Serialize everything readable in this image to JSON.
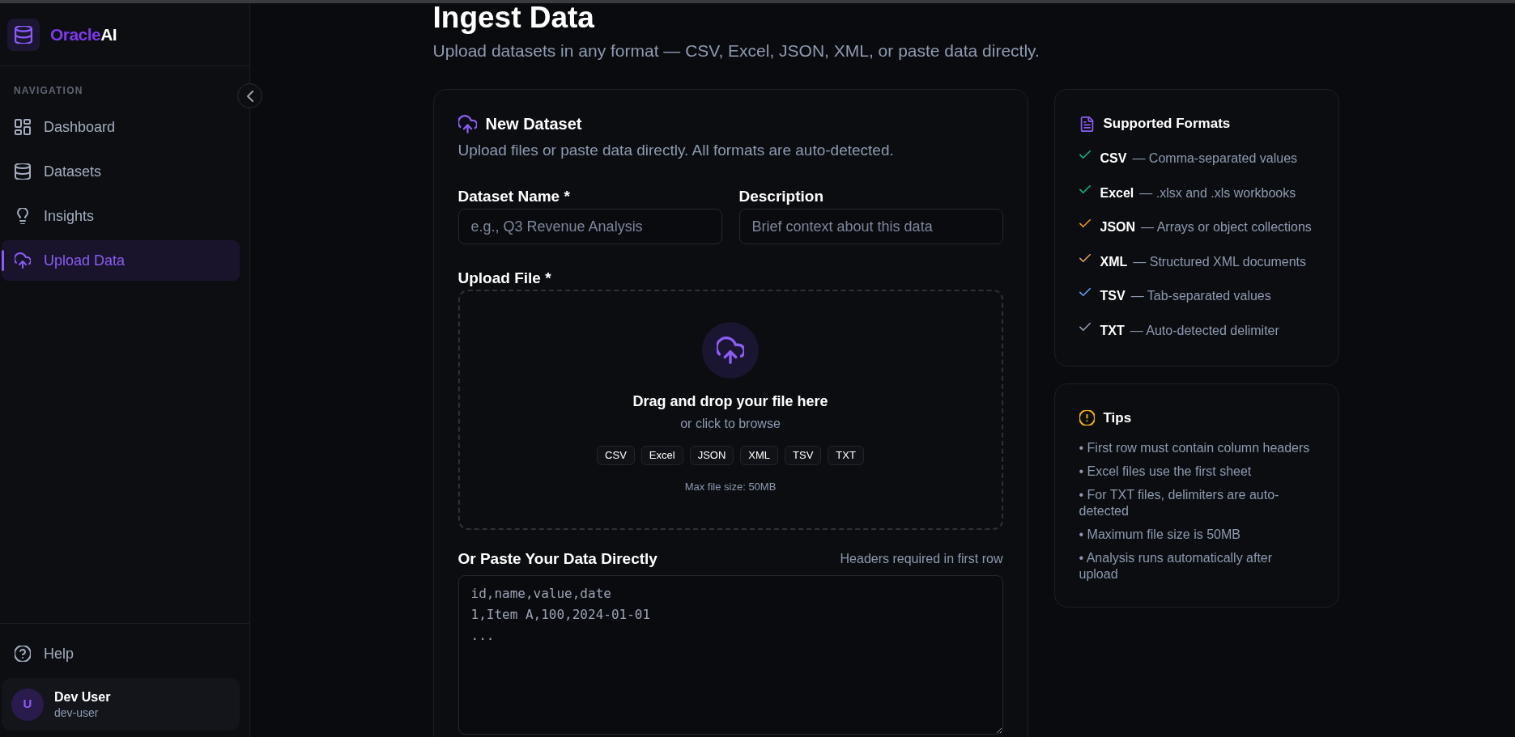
{
  "sidebar": {
    "brand": {
      "name": "Oracle",
      "suffix": "AI"
    },
    "section_label": "NAVIGATION",
    "items": [
      {
        "label": "Dashboard",
        "selected": false
      },
      {
        "label": "Datasets",
        "selected": false
      },
      {
        "label": "Insights",
        "selected": false
      },
      {
        "label": "Upload Data",
        "selected": true
      }
    ],
    "help_link": "Help",
    "user": {
      "initial": "U",
      "name": "Dev User",
      "handle": "dev-user"
    }
  },
  "page": {
    "title": "Ingest Data",
    "subtitle": "Upload datasets in any format — CSV, Excel, JSON, XML, or paste data directly."
  },
  "new_dataset": {
    "title": "New Dataset",
    "subtitle": "Upload files or paste data directly. All formats are auto-detected.",
    "fields": [
      {
        "label": "Dataset Name *",
        "placeholder": "e.g., Q3 Revenue Analysis"
      },
      {
        "label": "Description",
        "placeholder": "Brief context about this data"
      }
    ],
    "upload": {
      "label": "Upload File *",
      "heading": "Drag and drop your file here",
      "hint": "or click to browse",
      "formats": [
        "CSV",
        "Excel",
        "JSON",
        "XML",
        "TSV",
        "TXT"
      ],
      "limit": "Max file size: 50MB"
    },
    "paste": {
      "label": "Or Paste Your Data Directly",
      "note": "Headers required in first row",
      "placeholder": "id,name,value,date\n1,Item A,100,2024-01-01\n..."
    }
  },
  "supported_formats": {
    "title": "Supported Formats",
    "items": [
      {
        "name": "CSV",
        "description": "— Comma-separated values",
        "color": "#10b981"
      },
      {
        "name": "Excel",
        "description": "— .xlsx and .xls workbooks",
        "color": "#10b981"
      },
      {
        "name": "JSON",
        "description": "— Arrays or object collections",
        "color": "#f59e0b"
      },
      {
        "name": "XML",
        "description": "— Structured XML documents",
        "color": "#e8a05a"
      },
      {
        "name": "TSV",
        "description": "— Tab-separated values",
        "color": "#60a5fa"
      },
      {
        "name": "TXT",
        "description": "— Auto-detected delimiter",
        "color": "#94a3b8"
      }
    ]
  },
  "tips": {
    "title": "Tips",
    "items": [
      "• First row must contain column headers",
      "• Excel files use the first sheet",
      "• For TXT files, delimiters are auto-detected",
      "• Maximum file size is 50MB",
      "• Analysis runs automatically after upload"
    ]
  }
}
